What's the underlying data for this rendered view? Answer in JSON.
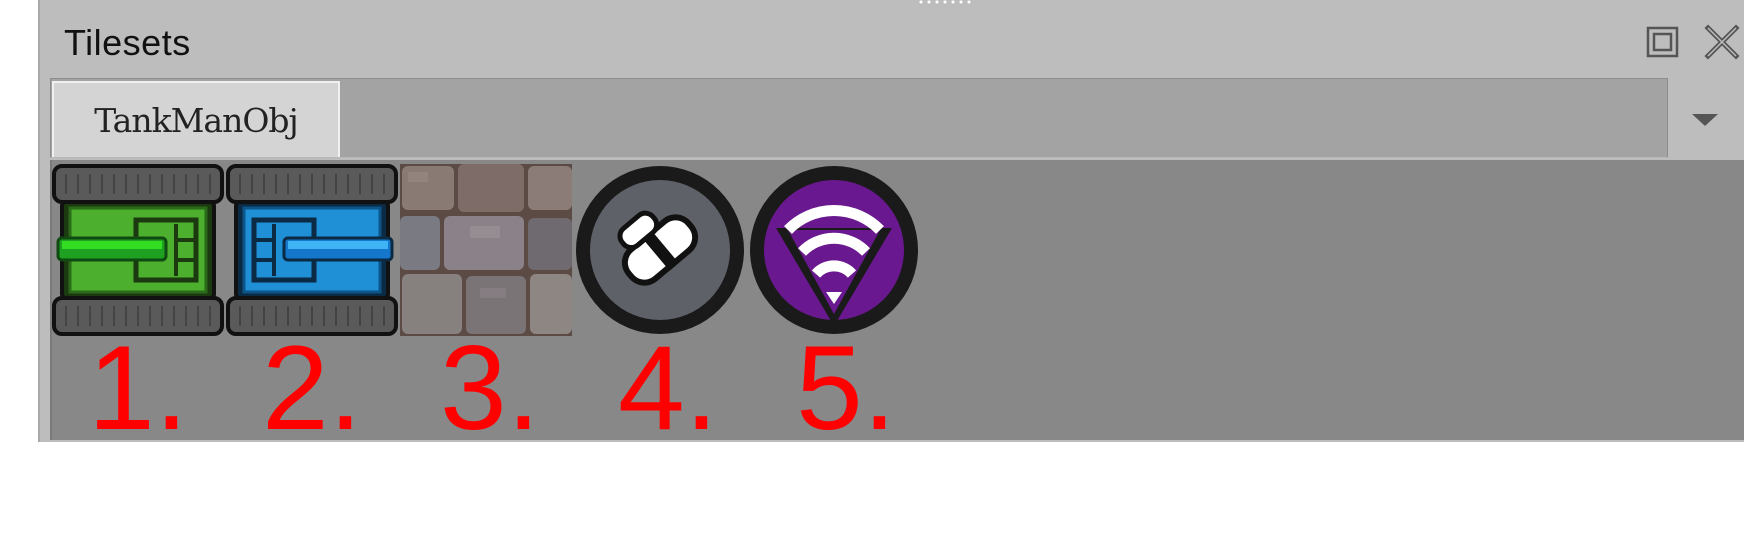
{
  "panel": {
    "title": "Tilesets",
    "float_button_icon": "float-window-icon",
    "close_button_icon": "close-icon"
  },
  "tabs": [
    {
      "label": "TankManObj",
      "selected": true
    }
  ],
  "tab_menu_icon": "dropdown-arrow-icon",
  "tiles": [
    {
      "icon": "green-tank-icon",
      "number": "1."
    },
    {
      "icon": "blue-tank-icon",
      "number": "2."
    },
    {
      "icon": "stone-wall-texture",
      "number": "3."
    },
    {
      "icon": "gray-bandage-pickup-icon",
      "number": "4."
    },
    {
      "icon": "purple-signal-pickup-icon",
      "number": "5."
    }
  ],
  "colors": {
    "panel_bg": "#bdbdbd",
    "tile_area_bg": "#888888",
    "annotation": "#ff0000",
    "green_tank": "#4caf2e",
    "blue_tank": "#1f8fd6",
    "purple_pickup": "#6a1890"
  }
}
